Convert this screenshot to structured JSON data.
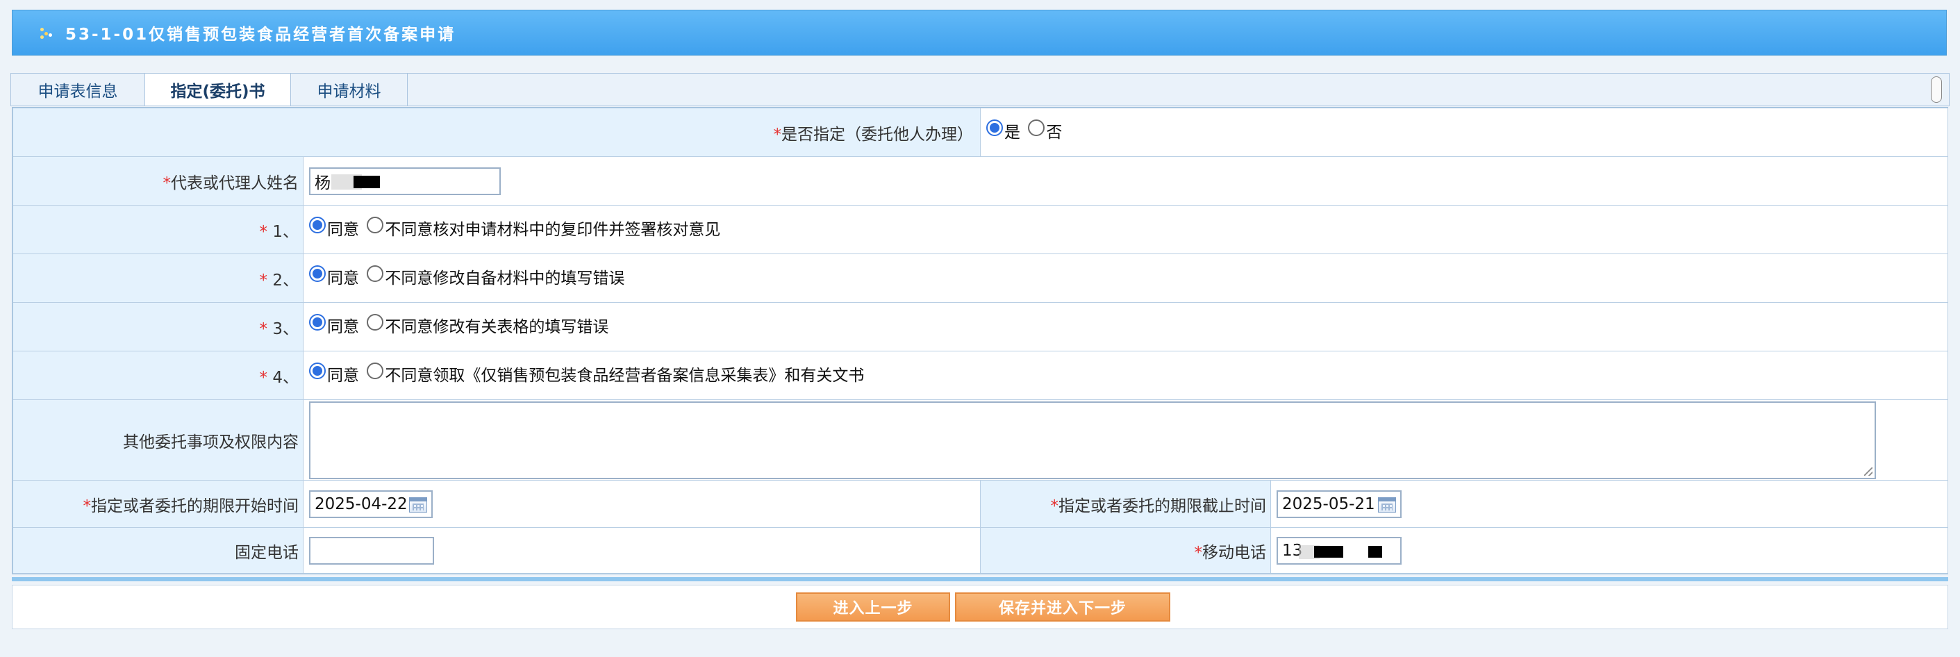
{
  "title": "53-1-01仅销售预包装食品经营者首次备案申请",
  "tabs": [
    {
      "label": "申请表信息",
      "active": false
    },
    {
      "label": "指定(委托)书",
      "active": true
    },
    {
      "label": "申请材料",
      "active": false
    }
  ],
  "form": {
    "designated": {
      "label": "是否指定（委托他人办理）",
      "required": true,
      "options": [
        "是",
        "否"
      ],
      "selected": "是"
    },
    "agent_name": {
      "label": "代表或代理人姓名",
      "required": true,
      "value": "杨"
    },
    "items": [
      {
        "label": "1、",
        "required": true,
        "agree": "同意",
        "disagree": "不同意核对申请材料中的复印件并签署核对意见",
        "selected": "同意"
      },
      {
        "label": "2、",
        "required": true,
        "agree": "同意",
        "disagree": "不同意修改自备材料中的填写错误",
        "selected": "同意"
      },
      {
        "label": "3、",
        "required": true,
        "agree": "同意",
        "disagree": "不同意修改有关表格的填写错误",
        "selected": "同意"
      },
      {
        "label": "4、",
        "required": true,
        "agree": "同意",
        "disagree": "不同意领取《仅销售预包装食品经营者备案信息采集表》和有关文书",
        "selected": "同意"
      }
    ],
    "other_matters": {
      "label": "其他委托事项及权限内容",
      "value": ""
    },
    "start_date": {
      "label": "指定或者委托的期限开始时间",
      "required": true,
      "value": "2025-04-22"
    },
    "end_date": {
      "label": "指定或者委托的期限截止时间",
      "required": true,
      "value": "2025-05-21"
    },
    "landline": {
      "label": "固定电话",
      "value": ""
    },
    "mobile": {
      "label": "移动电话",
      "required": true,
      "value": "13"
    }
  },
  "buttons": {
    "prev": "进入上一步",
    "next": "保存并进入下一步"
  },
  "colors": {
    "title_bar": "#4aa8f2",
    "label_bg": "#e4f2fd",
    "required_mark": "#e53030",
    "button": "#f5a560",
    "radio_checked": "#2d6fe0"
  }
}
